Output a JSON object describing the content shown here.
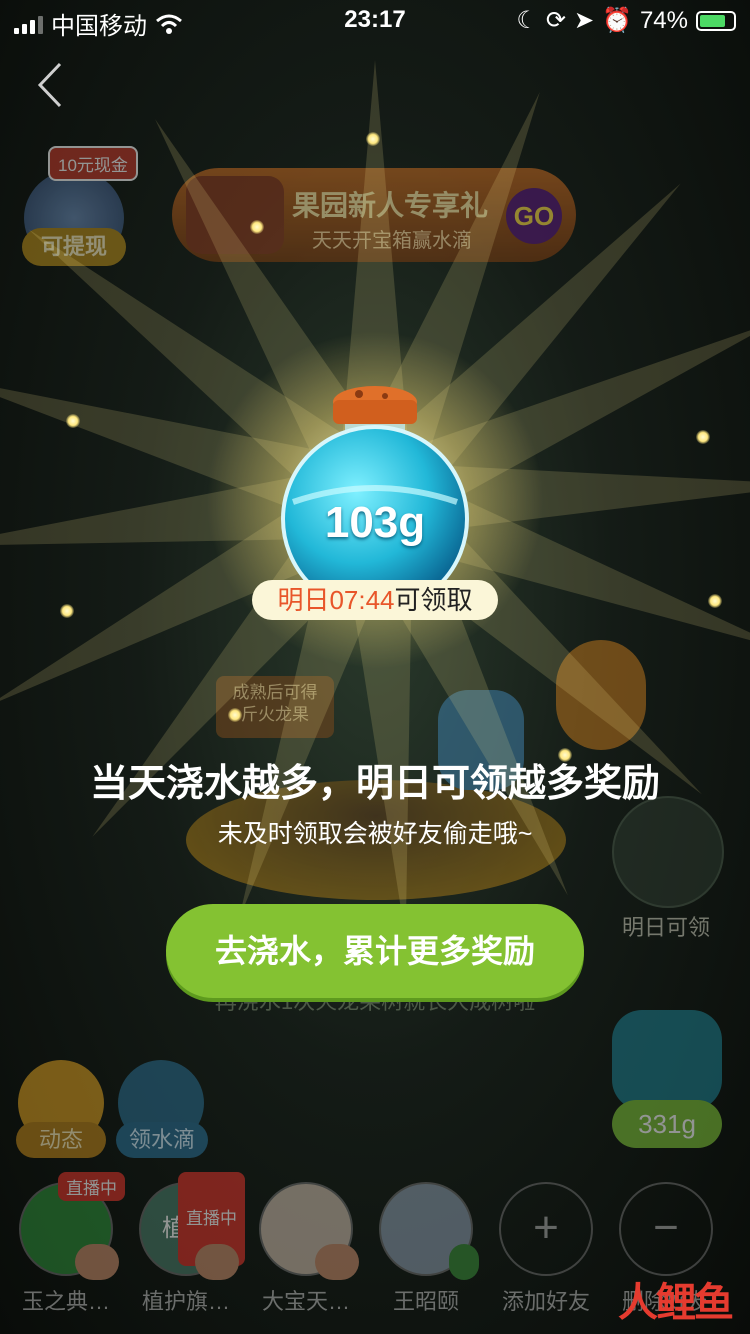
{
  "status_bar": {
    "carrier": "中国移动",
    "time": "23:17",
    "battery": "74%"
  },
  "background": {
    "cash_badge": "10元现金",
    "cash_label": "可提现",
    "banner_title": "果园新人专享礼",
    "banner_subtitle": "天天开宝箱赢水滴",
    "banner_go": "GO",
    "sign_line1": "成熟后可得",
    "sign_line2": "斤火龙果",
    "tomorrow_label": "明日可领",
    "kettle_amount": "331g",
    "dynamic_label": "动态",
    "collect_label": "领水滴",
    "hidden_hint": "再浇水1次火龙果树就长大成树啦"
  },
  "friends": [
    {
      "name": "玉之典…",
      "live": "直播中"
    },
    {
      "name": "植护旗…",
      "live": "直播中",
      "avatar_text": "植护"
    },
    {
      "name": "大宝天…"
    },
    {
      "name": "王昭颐"
    },
    {
      "name": "添加好友",
      "symbol": "+"
    },
    {
      "name": "删除好友",
      "symbol": "−"
    }
  ],
  "modal": {
    "water_amount": "103g",
    "time_highlight": "明日07:44",
    "time_suffix": "可领取",
    "headline": "当天浇水越多，明日可领越多奖励",
    "subline": "未及时领取会被好友偷走哦~",
    "cta": "去浇水，累计更多奖励"
  },
  "watermark": "人鲤鱼",
  "colors": {
    "cta": "#84c232",
    "highlight": "#e8562a",
    "live_badge": "#d9342b"
  }
}
